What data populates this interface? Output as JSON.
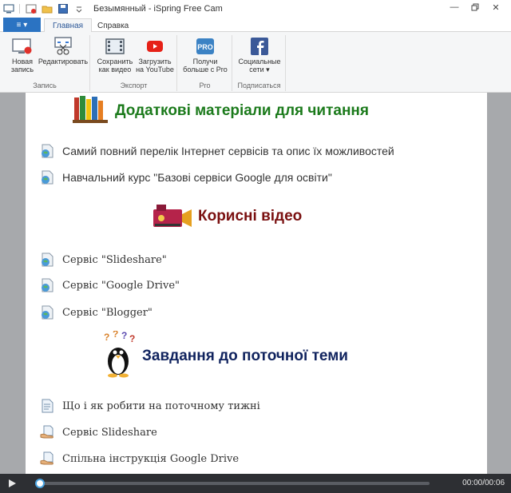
{
  "window": {
    "title": "Безымянный - iSpring Free Cam",
    "app_icon": "ispring-app-icon",
    "quick_access": [
      "record-icon",
      "open-folder-icon",
      "save-icon",
      "customize-dropdown-icon"
    ],
    "controls": [
      "minimize",
      "restore",
      "close"
    ]
  },
  "ribbon": {
    "app_menu_label": "≡ ▾",
    "tabs": [
      {
        "label": "Главная",
        "active": true
      },
      {
        "label": "Справка",
        "active": false
      }
    ],
    "groups": [
      {
        "label": "Запись",
        "buttons": [
          {
            "label": "Новая\nзапись",
            "icon": "new-recording-icon"
          },
          {
            "label": "Редактировать",
            "icon": "edit-icon"
          }
        ]
      },
      {
        "label": "Экспорт",
        "buttons": [
          {
            "label": "Сохранить\nкак видео",
            "icon": "save-video-icon"
          },
          {
            "label": "Загрузить\nна YouTube",
            "icon": "youtube-icon"
          }
        ]
      },
      {
        "label": "Pro",
        "buttons": [
          {
            "label": "Получи\nбольше с Pro",
            "icon": "pro-icon"
          }
        ]
      },
      {
        "label": "Подписаться",
        "buttons": [
          {
            "label": "Социальные\nсети ▾",
            "icon": "facebook-icon"
          }
        ]
      }
    ],
    "pro_badge": "PRO"
  },
  "document": {
    "sections": [
      {
        "heading": "Додаткові матеріали для читання",
        "heading_color": "#1b7a1b",
        "icon": "books-icon",
        "links": [
          {
            "text": "Самий повний перелік Інтернет сервісів та опис їх можливостей",
            "icon": "globe-page-icon"
          },
          {
            "text": "Навчальний курс \"Базові сервіси Google для освіти\"",
            "icon": "globe-page-icon"
          }
        ]
      },
      {
        "heading": "Корисні відео",
        "heading_color": "#7a1010",
        "icon": "video-camera-icon",
        "links": [
          {
            "text": "Сервіс \"Slideshare\"",
            "icon": "globe-page-icon"
          },
          {
            "text": "Сервіс \"Google Drive\"",
            "icon": "globe-page-icon"
          },
          {
            "text": "Сервіс \"Blogger\"",
            "icon": "globe-page-icon"
          }
        ]
      },
      {
        "heading": "Завдання до поточної теми",
        "heading_color": "#10235e",
        "icon": "penguin-question-icon",
        "links": [
          {
            "text": "Що і як робити на поточному тижні",
            "icon": "document-icon"
          },
          {
            "text": "Сервіс Slideshare",
            "icon": "hand-document-icon"
          },
          {
            "text": "Спільна інструкція Google Drive",
            "icon": "hand-document-icon"
          }
        ]
      }
    ]
  },
  "player": {
    "time": "00:00/00:06",
    "progress": 0.0,
    "accent": "#4aa3e0"
  },
  "colors": {
    "ribbon_blue": "#2b73c2",
    "stage_gray": "#a7a9ac",
    "player_bg": "#2d2f33"
  }
}
